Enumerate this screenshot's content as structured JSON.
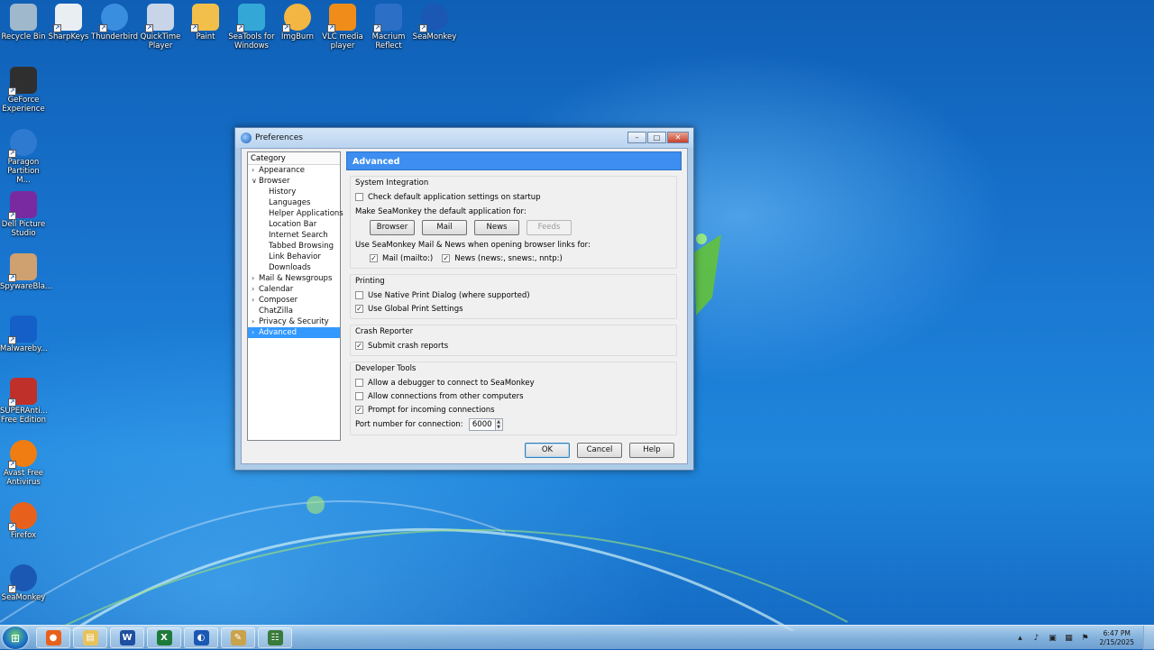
{
  "desktop_icons": [
    {
      "label": "Recycle Bin",
      "icon": "recycle-bin-icon",
      "color": "#9fb8cc"
    },
    {
      "label": "SharpKeys",
      "icon": "keyboard-icon",
      "color": "#e9eef2"
    },
    {
      "label": "Thunderbird",
      "icon": "thunderbird-icon",
      "color": "#3a8ee0"
    },
    {
      "label": "QuickTime Player",
      "icon": "quicktime-icon",
      "color": "#c8d4e8"
    },
    {
      "label": "Paint",
      "icon": "paint-icon",
      "color": "#f2c04a"
    },
    {
      "label": "SeaTools for Windows",
      "icon": "seatools-icon",
      "color": "#33a8d6"
    },
    {
      "label": "ImgBurn",
      "icon": "disc-icon",
      "color": "#f4b642"
    },
    {
      "label": "VLC media player",
      "icon": "vlc-icon",
      "color": "#f08c1a"
    },
    {
      "label": "Macrium Reflect",
      "icon": "macrium-icon",
      "color": "#2b6fc6"
    },
    {
      "label": "SeaMonkey",
      "icon": "seamonkey-icon",
      "color": "#1b58b4"
    },
    {
      "label": "GeForce Experience",
      "icon": "geforce-icon",
      "color": "#2f2f2f"
    },
    {
      "label": "Paragon Partition M...",
      "icon": "paragon-icon",
      "color": "#2f7ad1"
    },
    {
      "label": "Dell Picture Studio",
      "icon": "dell-picture-icon",
      "color": "#7a2aa0"
    },
    {
      "label": "SpywareBla...",
      "icon": "spyware-icon",
      "color": "#cfa070"
    },
    {
      "label": "Malwareby...",
      "icon": "malwarebytes-icon",
      "color": "#1560c8"
    },
    {
      "label": "SUPERAnti... Free Edition",
      "icon": "superantispyware-icon",
      "color": "#c0302a"
    },
    {
      "label": "Avast Free Antivirus",
      "icon": "avast-icon",
      "color": "#f07d12"
    },
    {
      "label": "Firefox",
      "icon": "firefox-icon",
      "color": "#e8611c"
    },
    {
      "label": "SeaMonkey",
      "icon": "seamonkey-icon",
      "color": "#1b58b4"
    }
  ],
  "dialog": {
    "title": "Preferences",
    "minimize": "–",
    "maximize": "□",
    "close": "✕",
    "category_header": "Category",
    "categories": [
      {
        "label": "Appearance",
        "level": 0,
        "twisty": "›"
      },
      {
        "label": "Browser",
        "level": 0,
        "twisty": "∨"
      },
      {
        "label": "History",
        "level": 1
      },
      {
        "label": "Languages",
        "level": 1
      },
      {
        "label": "Helper Applications",
        "level": 1
      },
      {
        "label": "Location Bar",
        "level": 1
      },
      {
        "label": "Internet Search",
        "level": 1
      },
      {
        "label": "Tabbed Browsing",
        "level": 1
      },
      {
        "label": "Link Behavior",
        "level": 1
      },
      {
        "label": "Downloads",
        "level": 1
      },
      {
        "label": "Mail & Newsgroups",
        "level": 0,
        "twisty": "›"
      },
      {
        "label": "Calendar",
        "level": 0,
        "twisty": "›"
      },
      {
        "label": "Composer",
        "level": 0,
        "twisty": "›"
      },
      {
        "label": "ChatZilla",
        "level": 0
      },
      {
        "label": "Privacy & Security",
        "level": 0,
        "twisty": "›"
      },
      {
        "label": "Advanced",
        "level": 0,
        "twisty": "›",
        "selected": true
      }
    ],
    "pane_title": "Advanced",
    "system_integration": {
      "title": "System Integration",
      "check_default": {
        "label": "Check default application settings on startup",
        "checked": false
      },
      "default_for_label": "Make SeaMonkey the default application for:",
      "buttons": [
        {
          "label": "Browser",
          "enabled": true
        },
        {
          "label": "Mail",
          "enabled": true
        },
        {
          "label": "News",
          "enabled": true
        },
        {
          "label": "Feeds",
          "enabled": false
        }
      ],
      "links_label": "Use SeaMonkey Mail & News when opening browser links for:",
      "mail_link": {
        "label": "Mail (mailto:)",
        "checked": true
      },
      "news_link": {
        "label": "News (news:, snews:, nntp:)",
        "checked": true
      }
    },
    "printing": {
      "title": "Printing",
      "native_dialog": {
        "label": "Use Native Print Dialog (where supported)",
        "checked": false
      },
      "global_settings": {
        "label": "Use Global Print Settings",
        "checked": true
      }
    },
    "crash_reporter": {
      "title": "Crash Reporter",
      "submit": {
        "label": "Submit crash reports",
        "checked": true
      }
    },
    "developer_tools": {
      "title": "Developer Tools",
      "allow_debugger": {
        "label": "Allow a debugger to connect to SeaMonkey",
        "checked": false
      },
      "allow_remote": {
        "label": "Allow connections from other computers",
        "checked": false
      },
      "prompt": {
        "label": "Prompt for incoming connections",
        "checked": true
      },
      "port_label": "Port number for connection:",
      "port_value": "6000"
    },
    "ok_label": "OK",
    "cancel_label": "Cancel",
    "help_label": "Help"
  },
  "check_glyph": "✓",
  "taskbar": {
    "start_glyph": "⊞",
    "items": [
      {
        "name": "taskbar-firefox",
        "icon": "firefox-icon",
        "glyph": "●",
        "color": "#e8611c"
      },
      {
        "name": "taskbar-explorer",
        "icon": "folder-icon",
        "glyph": "▤",
        "color": "#e8c25a"
      },
      {
        "name": "taskbar-word",
        "icon": "word-icon",
        "glyph": "W",
        "color": "#1f4fa0"
      },
      {
        "name": "taskbar-excel",
        "icon": "excel-icon",
        "glyph": "X",
        "color": "#1e7a3a"
      },
      {
        "name": "taskbar-seamonkey",
        "icon": "seamonkey-icon",
        "glyph": "◐",
        "color": "#1b58b4"
      },
      {
        "name": "taskbar-paint",
        "icon": "paint-icon",
        "glyph": "✎",
        "color": "#c9a24a"
      },
      {
        "name": "taskbar-network",
        "icon": "network-icon",
        "glyph": "☷",
        "color": "#3a7a3a"
      }
    ],
    "tray": [
      {
        "icon": "chevron-up-icon",
        "glyph": "▴"
      },
      {
        "icon": "speaker-icon",
        "glyph": "♪"
      },
      {
        "icon": "monitor-icon",
        "glyph": "▣"
      },
      {
        "icon": "network-tray-icon",
        "glyph": "▦"
      },
      {
        "icon": "flag-icon",
        "glyph": "⚑"
      }
    ],
    "time": "6:47 PM",
    "date": "2/15/2025"
  }
}
